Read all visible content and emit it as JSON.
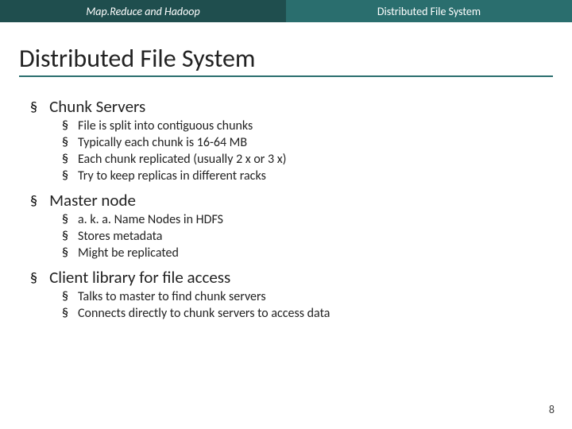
{
  "header": {
    "left": "Map.Reduce and Hadoop",
    "right": "Distributed File System"
  },
  "title": "Distributed File System",
  "sections": [
    {
      "label": "Chunk Servers",
      "items": [
        "File is split into contiguous chunks",
        "Typically each chunk is 16-64 MB",
        "Each chunk replicated (usually 2 x or 3 x)",
        "Try to keep replicas in different racks"
      ]
    },
    {
      "label": "Master node",
      "items": [
        "a. k. a. Name Nodes in HDFS",
        "Stores metadata",
        "Might be replicated"
      ]
    },
    {
      "label": "Client library for file access",
      "items": [
        "Talks to master to find chunk servers",
        "Connects directly to chunk servers to access data"
      ]
    }
  ],
  "page_number": "8"
}
